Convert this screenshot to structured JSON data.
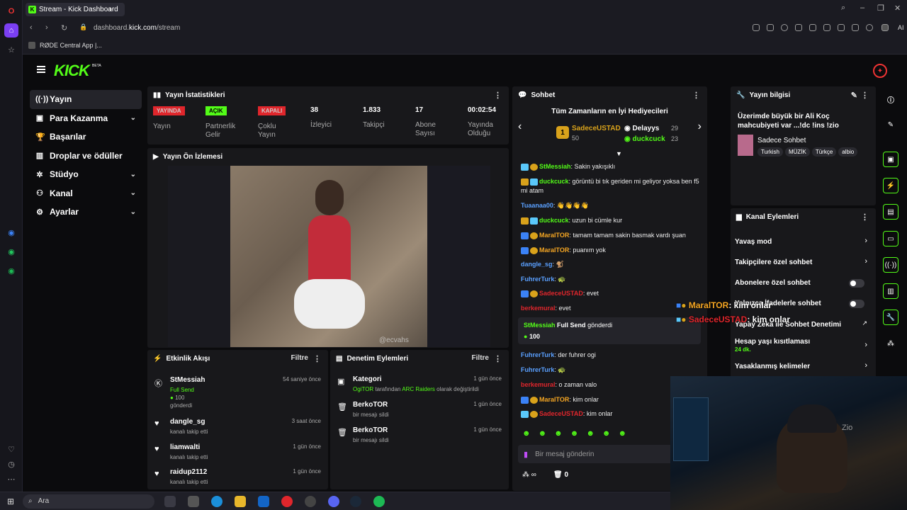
{
  "browser": {
    "tab_title": "Stream - Kick Dashboard",
    "url_prefix": "dashboard.",
    "url_domain": "kick.com",
    "url_path": "/stream",
    "bookmark": "RØDE Central App |...",
    "right_label": "AI"
  },
  "header": {
    "logo": "KICK",
    "logo_badge": "BETA"
  },
  "nav": [
    {
      "label": "Yayın",
      "icon": "broadcast-icon",
      "active": true,
      "chevron": false
    },
    {
      "label": "Para Kazanma",
      "icon": "money-icon",
      "chevron": true
    },
    {
      "label": "Başarılar",
      "icon": "trophy-icon",
      "chevron": false
    },
    {
      "label": "Droplar ve ödüller",
      "icon": "gift-icon",
      "chevron": false
    },
    {
      "label": "Stüdyo",
      "icon": "studio-icon",
      "chevron": true
    },
    {
      "label": "Kanal",
      "icon": "channel-icon",
      "chevron": true
    },
    {
      "label": "Ayarlar",
      "icon": "settings-icon",
      "chevron": true
    }
  ],
  "stats": {
    "title": "Yayın İstatistikleri",
    "items": [
      {
        "badge": "YAYINDA",
        "badge_color": "#e0262c",
        "label": "Yayın"
      },
      {
        "badge": "AÇIK",
        "badge_color": "#53fc18",
        "label": "Partnerlik Gelir"
      },
      {
        "badge": "KAPALI",
        "badge_color": "#e0262c",
        "label": "Çoklu Yayın"
      },
      {
        "value": "38",
        "label": "İzleyici"
      },
      {
        "value": "1.833",
        "label": "Takipçi"
      },
      {
        "value": "17",
        "label": "Abone Sayısı"
      },
      {
        "value": "00:02:54",
        "label": "Yayında Olduğu"
      }
    ]
  },
  "preview": {
    "title": "Yayın Ön İzlemesi",
    "watermark": "@ecvahs"
  },
  "activity": {
    "title": "Etkinlik Akışı",
    "filter": "Filtre",
    "items": [
      {
        "name": "StMessiah",
        "sub1": "Full Send",
        "sub2": "100",
        "sub3": "gönderdi",
        "time": "54 saniye önce"
      },
      {
        "name": "dangle_sg",
        "sub1": "kanalı takip etti",
        "time": "3 saat önce"
      },
      {
        "name": "liamwalti",
        "sub1": "kanalı takip etti",
        "time": "1 gün önce"
      },
      {
        "name": "raidup2112",
        "sub1": "kanalı takip etti",
        "time": "1 gün önce"
      }
    ]
  },
  "moderation": {
    "title": "Denetim Eylemleri",
    "filter": "Filtre",
    "items": [
      {
        "name": "Kategori",
        "user": "OgiTOR",
        "mid": "tarafından",
        "game": "ARC Raiders",
        "end": "olarak değiştirildi",
        "time": "1 gün önce"
      },
      {
        "name": "BerkoTOR",
        "sub": "bir mesajı sildi",
        "time": "1 gün önce"
      },
      {
        "name": "BerkoTOR",
        "sub": "bir mesajı sildi",
        "time": "1 gün önce"
      }
    ]
  },
  "chat": {
    "title": "Sohbet",
    "top_title": "Tüm Zamanların en İyi Hediyecileri",
    "top1_name": "SadeceUSTAD",
    "top1_score": "50",
    "top2_name": "Delayys",
    "top2_score": "29",
    "top3_name": "duckcuck",
    "top3_score": "23",
    "messages": [
      {
        "user": "StMessiah",
        "color": "#53fc18",
        "text": "Sakin yakışıklı"
      },
      {
        "user": "duckcuck",
        "color": "#53fc18",
        "text": "görüntü bi tık geriden mi geliyor yoksa ben f5 mi atam"
      },
      {
        "user": "Tuaanaa00",
        "color": "#5aa0ff",
        "text": "👋👋👋👋"
      },
      {
        "user": "duckcuck",
        "color": "#53fc18",
        "text": "uzun bi cümle kur"
      },
      {
        "user": "MaralTOR",
        "color": "#f5a623",
        "text": "tamam tamam sakin basmak vardı şuan"
      },
      {
        "user": "MaralTOR",
        "color": "#f5a623",
        "text": "puanım yok"
      },
      {
        "user": "dangle_sg",
        "color": "#5aa0ff",
        "text": "🐒"
      },
      {
        "user": "FuhrerTurk",
        "color": "#5aa0ff",
        "text": "🐢"
      },
      {
        "user": "SadeceUSTAD",
        "color": "#e0262c",
        "text": "evet"
      },
      {
        "user": "berkemural",
        "color": "#e0262c",
        "text": "evet"
      }
    ],
    "gift_user": "StMessiah",
    "gift_text": "Full Send",
    "gift_verb": "gönderdi",
    "gift_amount": "100",
    "messages2": [
      {
        "user": "FuhrerTurk",
        "color": "#5aa0ff",
        "text": "der fuhrer ogi"
      },
      {
        "user": "FuhrerTurk",
        "color": "#5aa0ff",
        "text": "🐢"
      },
      {
        "user": "berkemural",
        "color": "#e0262c",
        "text": "o zaman valo"
      },
      {
        "user": "MaralTOR",
        "color": "#f5a623",
        "text": "kim onlar"
      },
      {
        "user": "SadeceUSTAD",
        "color": "#e0262c",
        "text": "kim onlar"
      }
    ],
    "input_placeholder": "Bir mesaj gönderin",
    "footer_count": "0"
  },
  "info": {
    "title": "Yayın bilgisi",
    "stream_title": "Üzerimde büyük bir Ali Koç mahcubiyeti var ...!dc !ins !zio",
    "category": "Sadece Sohbet",
    "tags": [
      "Turkish",
      "MÜZİK",
      "Türkçe",
      "albio"
    ]
  },
  "channel_actions": {
    "title": "Kanal Eylemleri",
    "items": [
      {
        "label": "Yavaş mod",
        "type": "chevron"
      },
      {
        "label": "Takipçilere özel sohbet",
        "type": "chevron"
      },
      {
        "label": "Abonelere özel sohbet",
        "type": "toggle"
      },
      {
        "label": "Yalnızca İfadelerle sohbet",
        "type": "toggle"
      },
      {
        "label": "Yapay Zeka ile Sohbet Denetimi",
        "type": "link"
      },
      {
        "label": "Hesap yaşı kısıtlaması",
        "sub": "24 dk.",
        "type": "chevron"
      },
      {
        "label": "Yasaklanmış kelimeler",
        "type": "chevron"
      }
    ]
  },
  "overlay": {
    "line1_user": "MaralTOR",
    "line1_text": "kim onlar",
    "line2_user": "SadeceUSTAD",
    "line2_text": "kim onlar"
  },
  "webcam": {
    "text": "Zio"
  },
  "taskbar": {
    "search_placeholder": "Ara"
  }
}
